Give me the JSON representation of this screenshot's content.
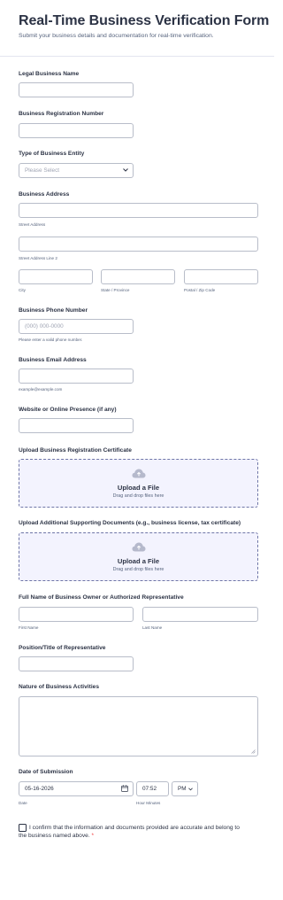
{
  "header": {
    "title": "Real-Time Business Verification Form",
    "subtitle": "Submit your business details and documentation for real-time verification."
  },
  "fields": {
    "legal_name": {
      "label": "Legal Business Name",
      "value": ""
    },
    "registration_number": {
      "label": "Business Registration Number",
      "value": ""
    },
    "entity_type": {
      "label": "Type of Business Entity",
      "selected": "Please Select"
    },
    "address": {
      "label": "Business Address",
      "street_sub": "Street Address",
      "street2_sub": "Street Address Line 2",
      "city_sub": "City",
      "state_sub": "State / Province",
      "zip_sub": "Postal / Zip Code"
    },
    "phone": {
      "label": "Business Phone Number",
      "placeholder": "(000) 000-0000",
      "sub": "Please enter a valid phone number."
    },
    "email": {
      "label": "Business Email Address",
      "sub": "example@example.com"
    },
    "website": {
      "label": "Website or Online Presence (if any)"
    },
    "upload_registration": {
      "label": "Upload Business Registration Certificate",
      "title": "Upload a File",
      "sub": "Drag and drop files here"
    },
    "upload_supporting": {
      "label": "Upload Additional Supporting Documents (e.g., business license, tax certificate)",
      "title": "Upload a File",
      "sub": "Drag and drop files here"
    },
    "representative": {
      "label": "Full Name of Business Owner or Authorized Representative",
      "first_sub": "First Name",
      "last_sub": "Last Name"
    },
    "position": {
      "label": "Position/Title of Representative"
    },
    "nature": {
      "label": "Nature of Business Activities"
    },
    "submission_date": {
      "label": "Date of Submission",
      "date": "05-16-2026",
      "time": "07:52",
      "ampm": "PM",
      "date_sub": "Date",
      "time_sub": "Hour Minutes"
    },
    "confirm": {
      "text": "I confirm that the information and documents provided are accurate and belong to the business named above.",
      "required_mark": "*"
    }
  },
  "icons": {
    "upload": "cloud-upload-icon",
    "select": "chevron-down-icon",
    "calendar": "calendar-icon"
  },
  "colors": {
    "title": "#2c3345",
    "upload_bg": "#f3f3fe",
    "upload_border": "#6f76a7",
    "required": "#f23a3c"
  }
}
